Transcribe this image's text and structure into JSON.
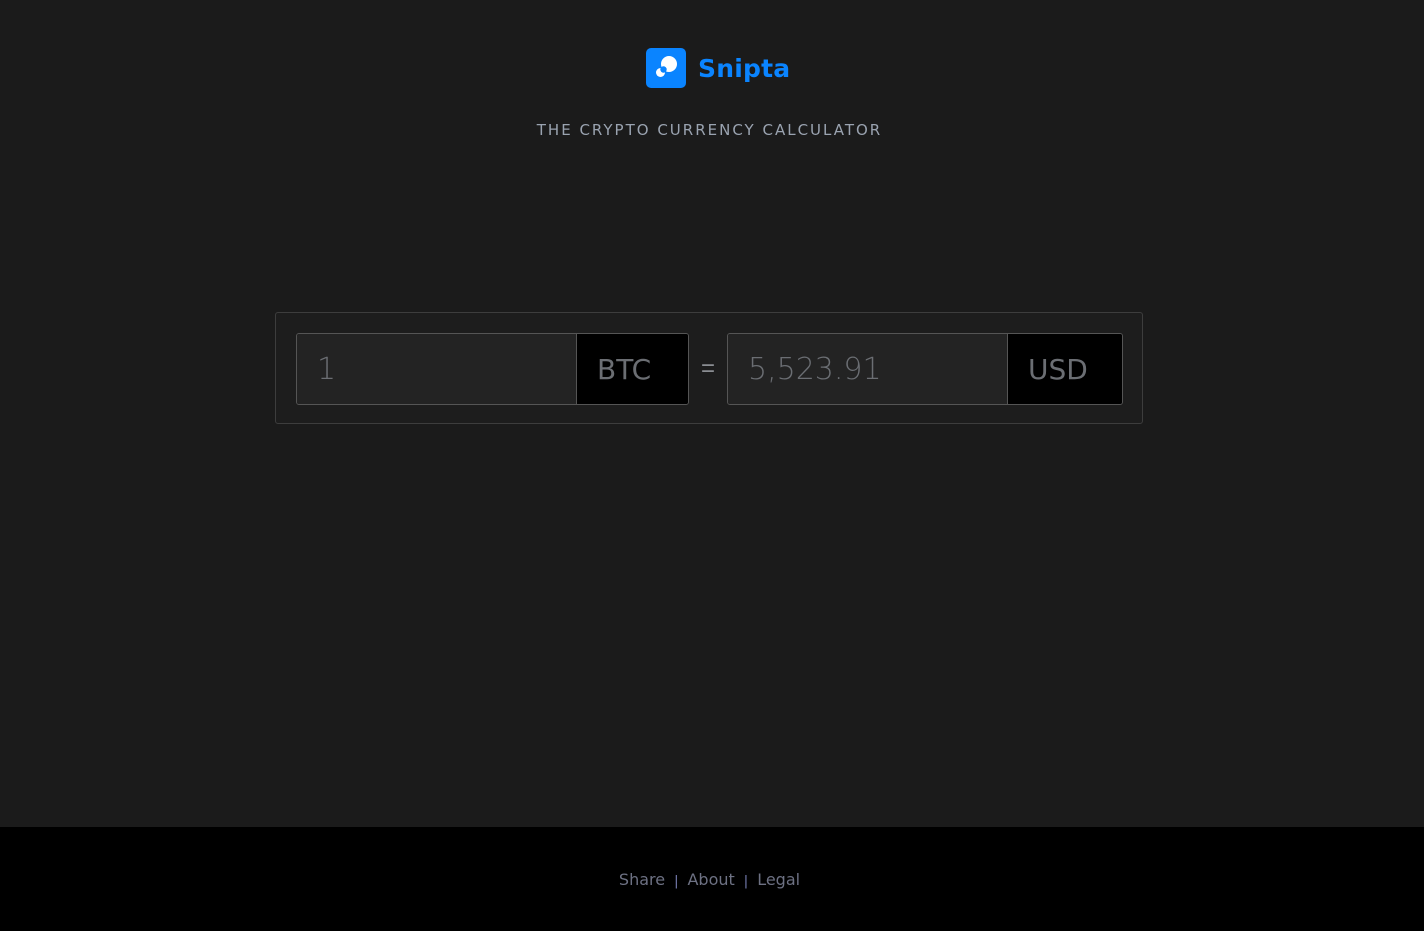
{
  "brand": {
    "name": "Snipta",
    "tagline": "THE CRYPTO CURRENCY CALCULATOR",
    "color": "#0a84ff"
  },
  "calculator": {
    "from": {
      "amount": "1",
      "currency": "BTC"
    },
    "equals": "=",
    "to": {
      "amount": "5,523.91",
      "currency": "USD"
    }
  },
  "footer": {
    "links": [
      "Share",
      "About",
      "Legal"
    ],
    "separator": "|"
  }
}
